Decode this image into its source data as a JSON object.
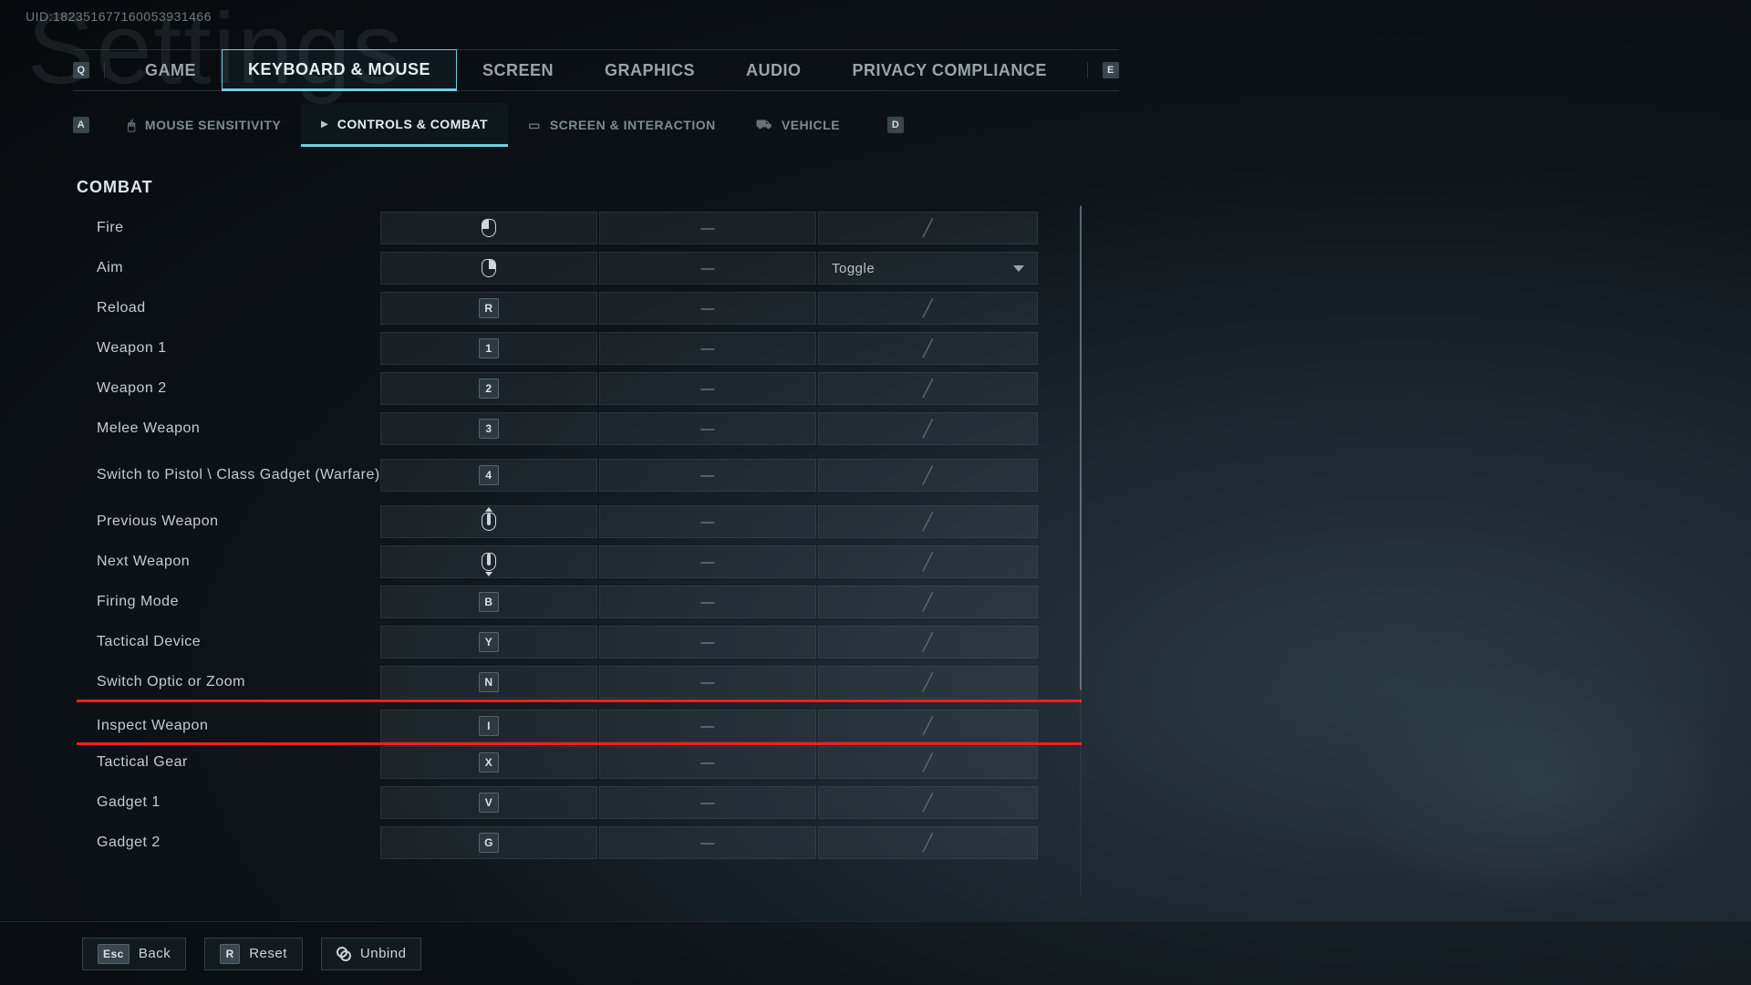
{
  "uid": "UID:182351677160053931466",
  "bg_title": "Settings",
  "nav_hint_left": "Q",
  "nav_hint_right": "E",
  "tabs": {
    "game": "GAME",
    "keyboard": "KEYBOARD & MOUSE",
    "screen": "SCREEN",
    "graphics": "GRAPHICS",
    "audio": "AUDIO",
    "privacy": "PRIVACY COMPLIANCE"
  },
  "subnav_hint_left": "A",
  "subnav_hint_right": "D",
  "subtabs": {
    "mouse": "MOUSE SENSITIVITY",
    "controls": "CONTROLS & COMBAT",
    "screen": "SCREEN & INTERACTION",
    "vehicle": "VEHICLE"
  },
  "section": "COMBAT",
  "rows": {
    "fire": "Fire",
    "aim": "Aim",
    "reload": "Reload",
    "weapon1": "Weapon 1",
    "weapon2": "Weapon 2",
    "melee": "Melee Weapon",
    "switch_pistol": "Switch to Pistol \\ Class Gadget (Warfare)",
    "prev_weapon": "Previous Weapon",
    "next_weapon": "Next Weapon",
    "firing_mode": "Firing Mode",
    "tactical_device": "Tactical Device",
    "switch_optic": "Switch Optic or Zoom",
    "inspect_weapon": "Inspect Weapon",
    "tactical_gear": "Tactical Gear",
    "gadget1": "Gadget 1",
    "gadget2": "Gadget 2"
  },
  "keys": {
    "reload": "R",
    "weapon1": "1",
    "weapon2": "2",
    "melee": "3",
    "switch_pistol": "4",
    "firing_mode": "B",
    "tactical_device": "Y",
    "switch_optic": "N",
    "inspect_weapon": "I",
    "tactical_gear": "X",
    "gadget1": "V",
    "gadget2": "G"
  },
  "aim_mode": "Toggle",
  "footer": {
    "back_key": "Esc",
    "back": "Back",
    "reset_key": "R",
    "reset": "Reset",
    "unbind": "Unbind"
  }
}
